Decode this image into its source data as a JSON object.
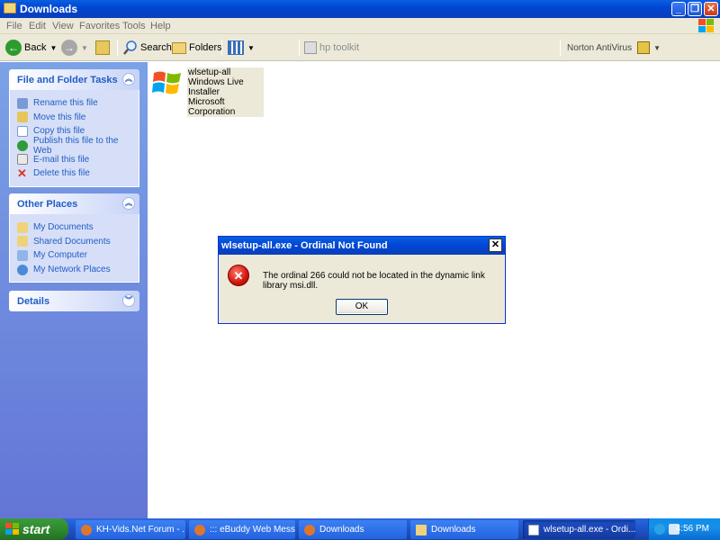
{
  "window": {
    "title": "Downloads"
  },
  "menu": [
    "File",
    "Edit",
    "View",
    "Favorites",
    "Tools",
    "Help"
  ],
  "toolbar": {
    "back": "Back",
    "search": "Search",
    "folders": "Folders",
    "hp_toolkit": "hp toolkit",
    "norton": "Norton AntiVirus"
  },
  "left_pane": {
    "file_tasks": {
      "title": "File and Folder Tasks",
      "items": [
        "Rename this file",
        "Move this file",
        "Copy this file",
        "Publish this file to the Web",
        "E-mail this file",
        "Delete this file"
      ]
    },
    "other_places": {
      "title": "Other Places",
      "items": [
        "My Documents",
        "Shared Documents",
        "My Computer",
        "My Network Places"
      ]
    },
    "details": {
      "title": "Details"
    }
  },
  "file": {
    "name": "wlsetup-all",
    "description": "Windows Live Installer",
    "company": "Microsoft Corporation"
  },
  "dialog": {
    "title": "wlsetup-all.exe - Ordinal Not Found",
    "message": "The ordinal 266 could not be located in the dynamic link library msi.dll.",
    "ok": "OK"
  },
  "taskbar": {
    "start": "start",
    "tasks": [
      "KH-Vids.Net Forum - ...",
      "::: eBuddy Web Mess...",
      "Downloads",
      "Downloads",
      "wlsetup-all.exe - Ordi..."
    ],
    "clock": "4:56 PM"
  },
  "colors": {
    "titlebar": "#0046d5",
    "pane_link": "#215dc6",
    "taskbar": "#245edb",
    "start": "#2f8a2f",
    "error_icon": "#d3130b"
  }
}
